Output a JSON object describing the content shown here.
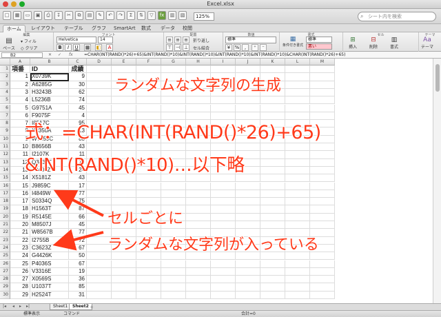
{
  "window": {
    "title": "Excel.xlsx"
  },
  "toolbar": {
    "zoom": "125%",
    "search_placeholder": "シート内を検索"
  },
  "ribbon_tabs": [
    "ホーム",
    "レイアウト",
    "テーブル",
    "グラフ",
    "SmartArt",
    "数式",
    "データ",
    "校閲"
  ],
  "ribbon": {
    "groups": [
      "編集",
      "フォント",
      "配置",
      "数値",
      "書式",
      "セル",
      "テーマ"
    ],
    "fill": "フィル",
    "clear": "クリア",
    "paste": "ペースト",
    "font_name": "Helvetica",
    "font_size": "14",
    "wrap_text": "折り返し",
    "merge": "セル結合",
    "number_format": "標準",
    "cond_format": "条件付き書式",
    "style_normal": "標準",
    "style_bad": "悪い",
    "insert": "挿入",
    "delete": "削除",
    "format": "書式",
    "theme": "テーマ"
  },
  "formula_bar": {
    "name_box": "B2",
    "formula": "=CHAR(INT(RAND()*26)+65)&INT(RAND()*10)&INT(RAND()*10)&INT(RAND()*10)&INT(RAND()*10)&CHAR(INT(RAND()*26)+65)"
  },
  "columns": [
    "A",
    "B",
    "C",
    "D",
    "E",
    "F",
    "G",
    "H",
    "I",
    "J",
    "K",
    "L",
    "M"
  ],
  "table": {
    "headers": [
      "項番",
      "ID",
      "成績"
    ],
    "rows": [
      [
        "1",
        "X0739K",
        "9"
      ],
      [
        "2",
        "A6285G",
        "30"
      ],
      [
        "3",
        "H3243B",
        "62"
      ],
      [
        "4",
        "L5236B",
        "74"
      ],
      [
        "5",
        "G9751A",
        "45"
      ],
      [
        "6",
        "F9075F",
        "4"
      ],
      [
        "7",
        "I8517C",
        "95"
      ],
      [
        "8",
        "X8350A",
        "13"
      ],
      [
        "9",
        "W7159C",
        "88"
      ],
      [
        "10",
        "B8656B",
        "43"
      ],
      [
        "11",
        "I2107K",
        "11"
      ],
      [
        "12",
        "Q3436T",
        "73"
      ],
      [
        "13",
        "F3401Z",
        "24"
      ],
      [
        "14",
        "X5181Z",
        "43"
      ],
      [
        "15",
        "J9859C",
        "17"
      ],
      [
        "16",
        "I4849W",
        "77"
      ],
      [
        "17",
        "S0334Q",
        "75"
      ],
      [
        "18",
        "H1563T",
        "87"
      ],
      [
        "19",
        "R5145E",
        "66"
      ],
      [
        "20",
        "M8507J",
        "45"
      ],
      [
        "21",
        "W8567B",
        "77"
      ],
      [
        "22",
        "I2755B",
        "72"
      ],
      [
        "23",
        "C3623Z",
        "67"
      ],
      [
        "24",
        "G4426K",
        "50"
      ],
      [
        "25",
        "P4036S",
        "67"
      ],
      [
        "26",
        "V3316E",
        "19"
      ],
      [
        "27",
        "X0569S",
        "36"
      ],
      [
        "28",
        "U1037T",
        "85"
      ],
      [
        "29",
        "H2524T",
        "31"
      ]
    ]
  },
  "annotations": {
    "title": "ランダムな文字列の生成",
    "formula_line1": "式：=CHAR(INT(RAND()*26)+65)",
    "formula_line2": "&INT(RAND()*10)…以下略",
    "arrow_text1": "セルごとに",
    "arrow_text2": "ランダムな文字列が入っている",
    "color": "#ff3a1a"
  },
  "sheets": [
    "Sheet1",
    "Sheet2"
  ],
  "status": {
    "view": "標準表示",
    "mode": "コマンド",
    "sum": "合計=0"
  }
}
